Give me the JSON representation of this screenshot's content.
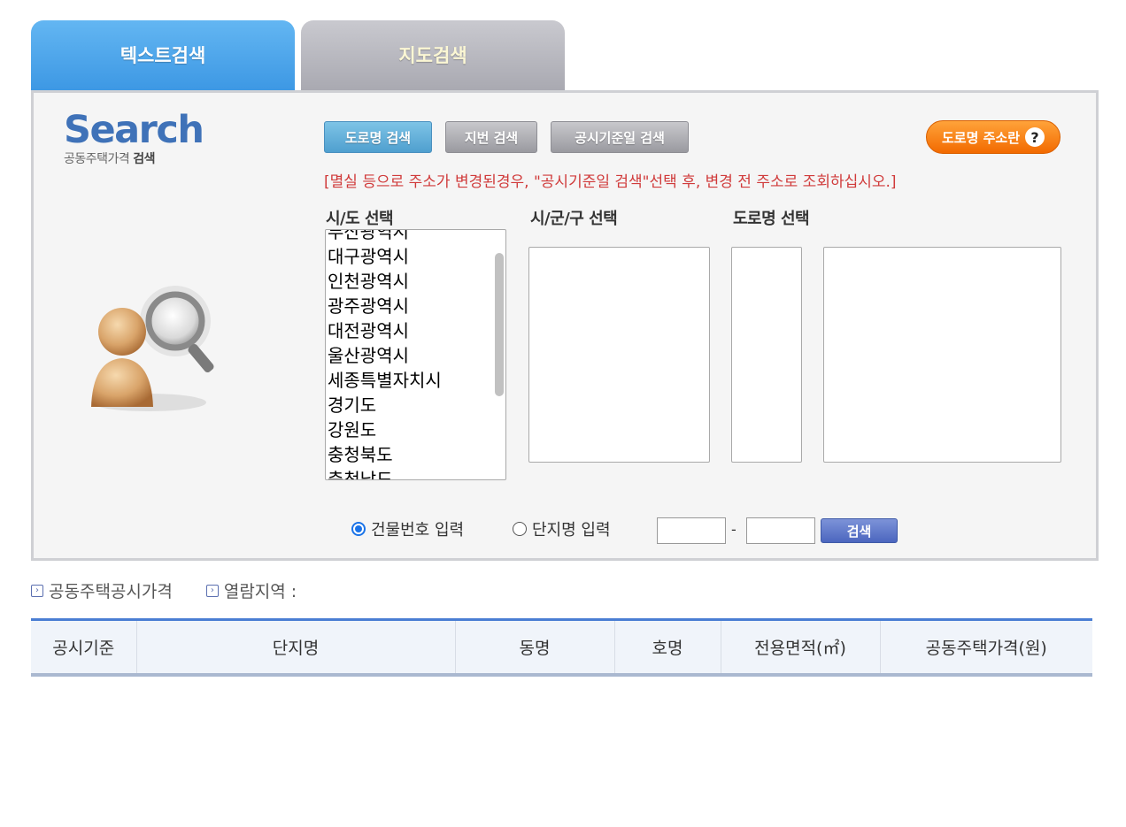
{
  "tabs": {
    "text_search": "텍스트검색",
    "map_search": "지도검색"
  },
  "logo": {
    "word": "Search",
    "sub_normal": "공동주택가격",
    "sub_bold": "검색"
  },
  "search_type_buttons": {
    "road": "도로명 검색",
    "lot": "지번 검색",
    "date": "공시기준일 검색"
  },
  "help_button": {
    "label": "도로명 주소란",
    "icon": "?"
  },
  "notice": "[멸실 등으로 주소가 변경된경우, \"공시기준일 검색\"선택 후, 변경 전 주소로 조회하십시오.]",
  "labels": {
    "sido": "시/도 선택",
    "sigungu": "시/군/구 선택",
    "road": "도로명 선택"
  },
  "sido_options": [
    "부산광역시",
    "대구광역시",
    "인천광역시",
    "광주광역시",
    "대전광역시",
    "울산광역시",
    "세종특별자치시",
    "경기도",
    "강원도",
    "충청북도",
    "충청남도"
  ],
  "input_mode": {
    "building_no": "건물번호 입력",
    "complex_name": "단지명 입력",
    "selected": "building_no"
  },
  "number_separator": "-",
  "search_button": "검색",
  "info": {
    "price_label": "공동주택공시가격",
    "region_label": "열람지역 :"
  },
  "table": {
    "headers": [
      "공시기준",
      "단지명",
      "동명",
      "호명",
      "전용면적(㎡)",
      "공동주택가격(원)"
    ]
  }
}
